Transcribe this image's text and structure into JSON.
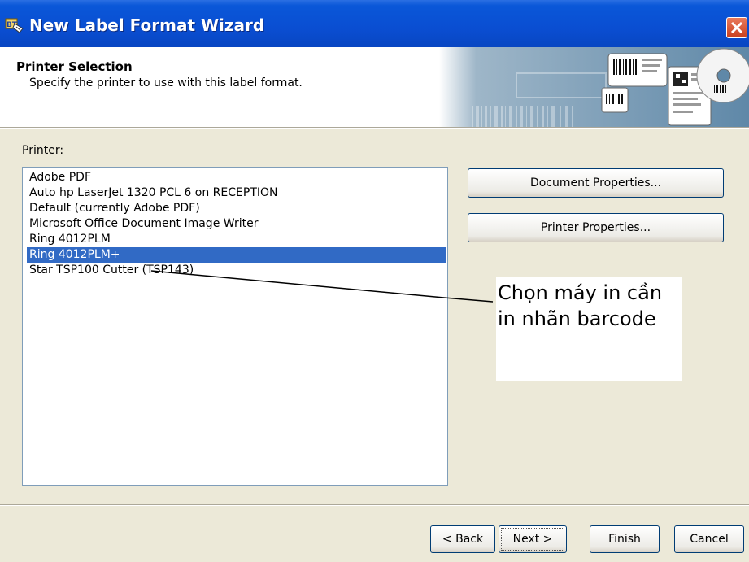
{
  "window": {
    "title": "New Label Format Wizard",
    "app_icon": "bartender-app-icon",
    "close_icon": "close-icon"
  },
  "header": {
    "title": "Printer Selection",
    "subtitle": "Specify the printer to use with this label format.",
    "graphic": "barcode-labels-banner"
  },
  "printer": {
    "label": "Printer:",
    "items": [
      "Adobe PDF",
      "Auto hp LaserJet 1320 PCL 6 on RECEPTION",
      "Default (currently Adobe PDF)",
      "Microsoft Office Document Image Writer",
      "Ring 4012PLM",
      "Ring 4012PLM+",
      "Star TSP100 Cutter (TSP143)"
    ],
    "selected_index": 5
  },
  "side_buttons": {
    "document_properties": "Document Properties...",
    "printer_properties": "Printer Properties..."
  },
  "annotation": {
    "text": "Chọn máy in cần\nin nhãn barcode"
  },
  "footer": {
    "back": "< Back",
    "next": "Next >",
    "finish": "Finish",
    "cancel": "Cancel"
  },
  "colors": {
    "titlebar": "#0a4ed2",
    "selection": "#316ac5",
    "dialog_bg": "#ece9d8"
  }
}
